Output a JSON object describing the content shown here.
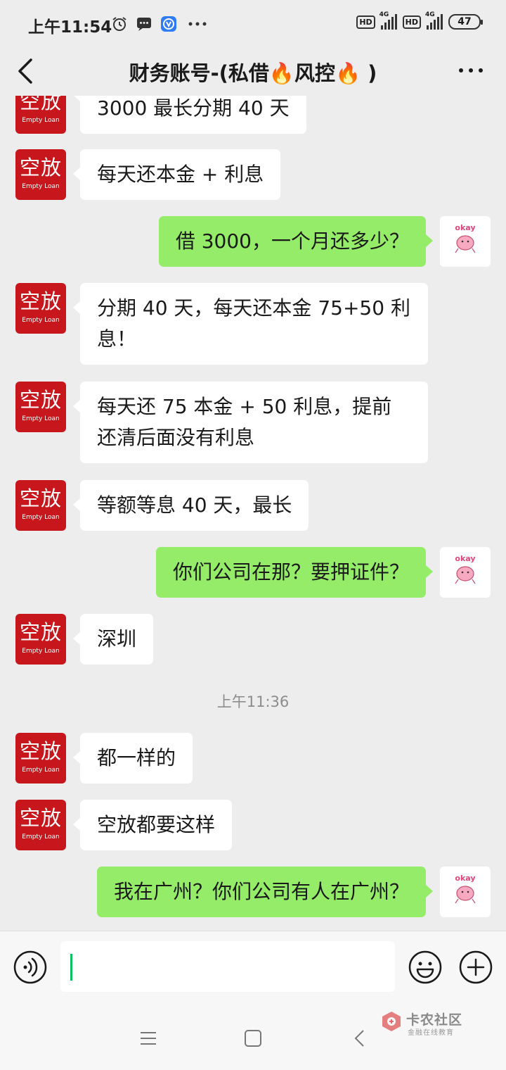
{
  "status_bar": {
    "time": "上午11:54",
    "network_1": "4G",
    "network_2": "4G",
    "hd_1": "HD",
    "hd_2": "HD",
    "battery": "47",
    "icons": [
      "alarm-icon",
      "message-icon",
      "app-icon",
      "more-dots-icon"
    ]
  },
  "header": {
    "title": "财务账号-(私借🔥风控🔥 )"
  },
  "contact_avatar": {
    "text": "空放",
    "subtext": "Empty Loan"
  },
  "messages": [
    {
      "side": "in",
      "text": "3000 最长分期 40 天"
    },
    {
      "side": "in",
      "text": "每天还本金 + 利息"
    },
    {
      "side": "out",
      "text": "借 3000，一个月还多少？"
    },
    {
      "side": "in",
      "text": "分期 40 天，每天还本金 75+50 利息！"
    },
    {
      "side": "in",
      "text": "每天还 75 本金 + 50 利息，提前还清后面没有利息"
    },
    {
      "side": "in",
      "text": "等额等息 40 天，最长"
    },
    {
      "side": "out",
      "text": "你们公司在那？要押证件？"
    },
    {
      "side": "in",
      "text": "深圳"
    },
    {
      "side": "time",
      "text": "上午11:36"
    },
    {
      "side": "in",
      "text": "都一样的"
    },
    {
      "side": "in",
      "text": "空放都要这样"
    },
    {
      "side": "out",
      "text": "我在广州？你们公司有人在广州？"
    }
  ],
  "watermark": {
    "title": "卡农社区",
    "subtitle": "金融在线教育"
  },
  "colors": {
    "incoming_bubble": "#ffffff",
    "outgoing_bubble": "#95ec69",
    "avatar_red": "#c8161d",
    "caret": "#07c160"
  }
}
